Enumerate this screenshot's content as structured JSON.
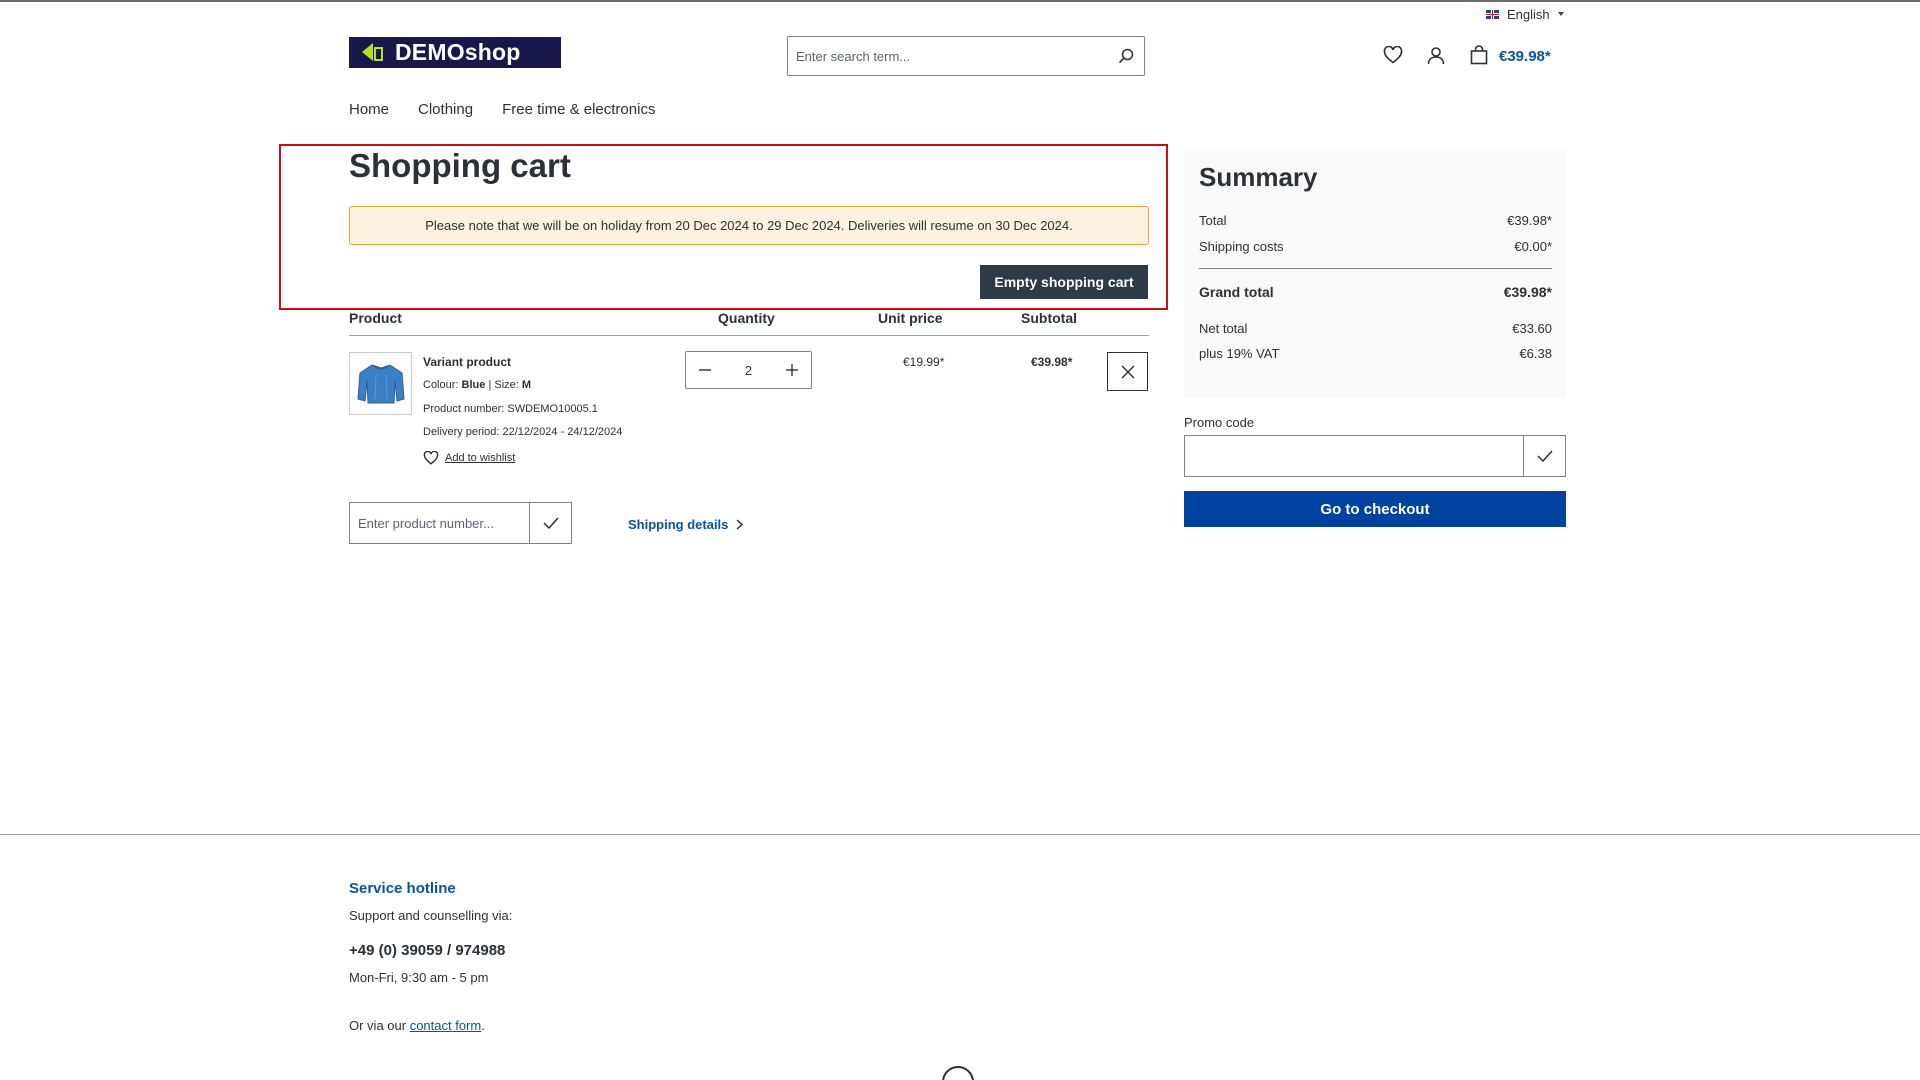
{
  "header": {
    "language": "English",
    "logo_text": "DEMOshop",
    "search_placeholder": "Enter search term...",
    "cart_total": "€39.98*"
  },
  "nav": {
    "items": [
      "Home",
      "Clothing",
      "Free time & electronics"
    ]
  },
  "cart": {
    "title": "Shopping cart",
    "notice": "Please note that we will be on holiday from 20 Dec 2024 to 29 Dec 2024. Deliveries will resume on 30 Dec 2024.",
    "empty_button": "Empty shopping cart",
    "columns": {
      "product": "Product",
      "quantity": "Quantity",
      "unit_price": "Unit price",
      "subtotal": "Subtotal"
    },
    "item": {
      "name": "Variant product",
      "colour_label": "Colour:",
      "colour_value": "Blue",
      "size_label": "Size:",
      "size_value": "M",
      "product_number": "Product number: SWDEMO10005.1",
      "delivery": "Delivery period: 22/12/2024 - 24/12/2024",
      "wishlist_label": "Add to wishlist",
      "quantity": "2",
      "unit_price": "€19.99*",
      "subtotal": "€39.98*"
    },
    "product_number_placeholder": "Enter product number...",
    "shipping_link": "Shipping details"
  },
  "summary": {
    "title": "Summary",
    "total_label": "Total",
    "total_value": "€39.98*",
    "shipping_label": "Shipping costs",
    "shipping_value": "€0.00*",
    "grand_label": "Grand total",
    "grand_value": "€39.98*",
    "net_label": "Net total",
    "net_value": "€33.60",
    "vat_label": "plus 19% VAT",
    "vat_value": "€6.38",
    "promo_label": "Promo code",
    "checkout_label": "Go to checkout"
  },
  "footer": {
    "hotline_title": "Service hotline",
    "support_text": "Support and counselling via:",
    "phone": "+49 (0) 39059 / 974988",
    "hours": "Mon-Fri, 9:30 am - 5 pm",
    "contact_prefix": "Or via our ",
    "contact_link": "contact form",
    "contact_suffix": "."
  },
  "colors": {
    "accent": "#0042a0",
    "link": "#0b539b",
    "highlight": "#cf0a1c",
    "notice_bg": "#fdf1e0",
    "notice_border": "#e8a33d"
  }
}
